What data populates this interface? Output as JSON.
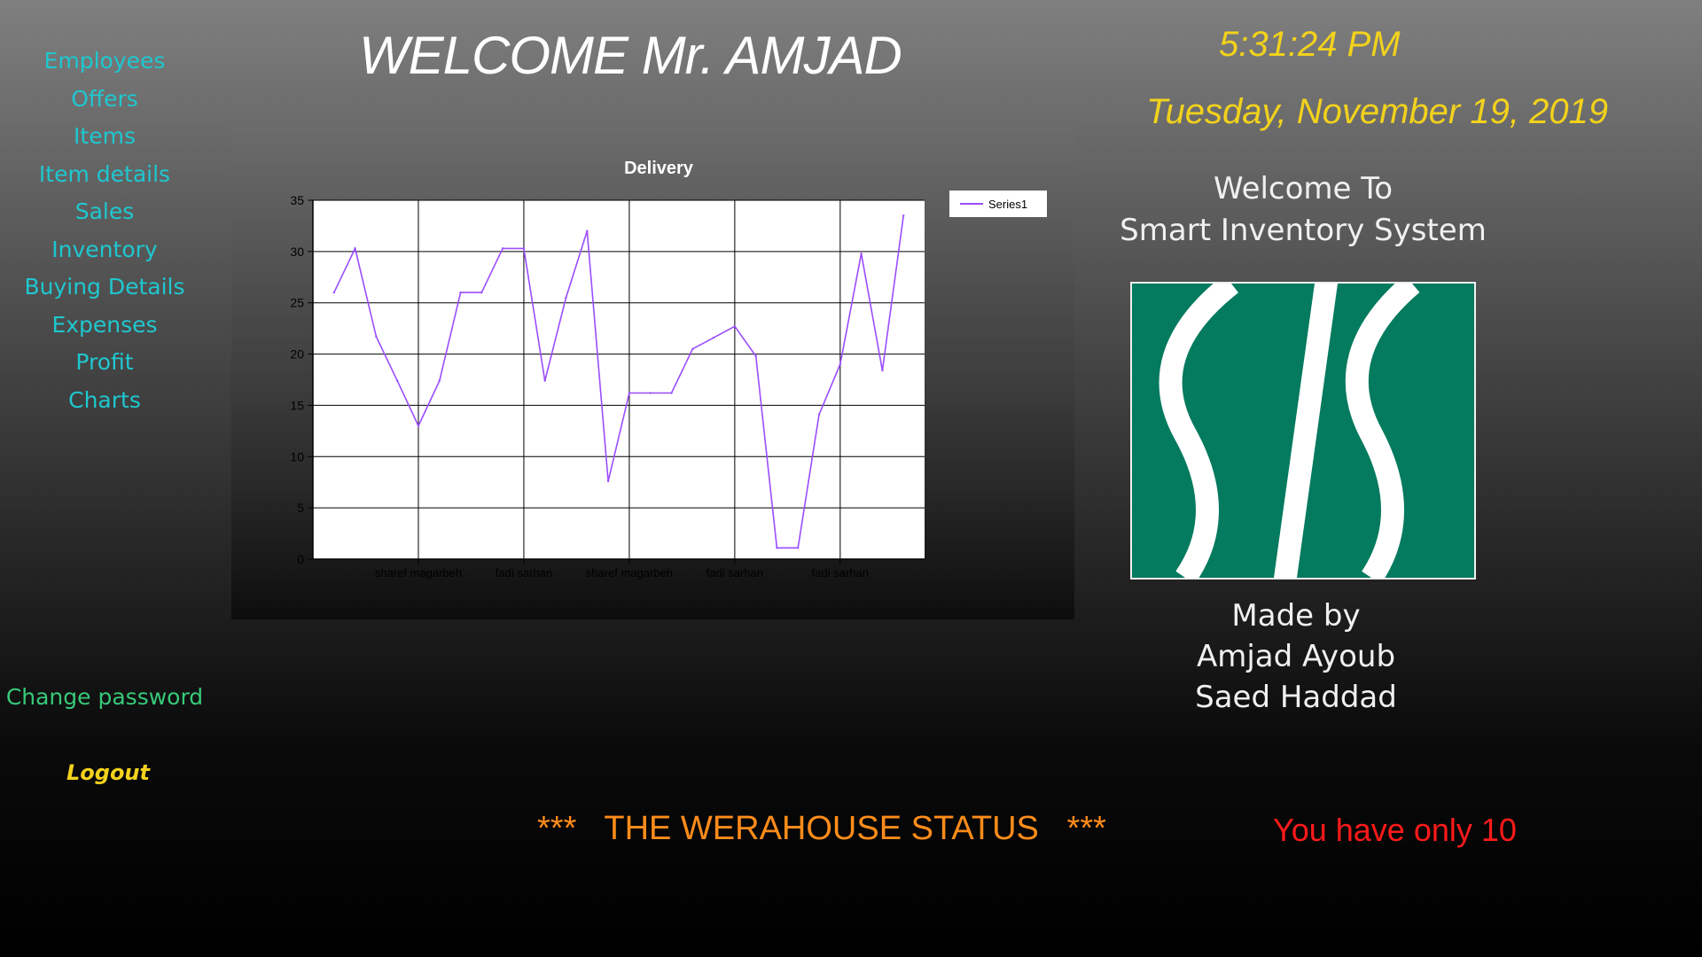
{
  "header": {
    "welcome": "WELCOME Mr. AMJAD",
    "time": "5:31:24 PM",
    "date": "Tuesday, November 19, 2019"
  },
  "nav": {
    "items": [
      {
        "label": "Employees"
      },
      {
        "label": "Offers"
      },
      {
        "label": "Items"
      },
      {
        "label": "Item details"
      },
      {
        "label": "Sales"
      },
      {
        "label": "Inventory"
      },
      {
        "label": "Buying Details"
      },
      {
        "label": "Expenses"
      },
      {
        "label": "Profit"
      },
      {
        "label": "Charts"
      }
    ],
    "change_password": "Change password",
    "logout": "Logout"
  },
  "info": {
    "welcome_line1": "Welcome To",
    "welcome_line2": "Smart Inventory System",
    "made_by": "Made by",
    "author1": "Amjad Ayoub",
    "author2": "Saed Haddad",
    "logo_alt": "SIS"
  },
  "footer": {
    "status": "***   THE WERAHOUSE STATUS   ***",
    "alert": "You have only 10"
  },
  "colors": {
    "nav": "#1fc7cf",
    "change_password": "#37c979",
    "accent_yellow": "#f2d21c",
    "status_orange": "#ff8c1a",
    "alert_red": "#ff1a1a",
    "logo_green": "#047a5e",
    "series_line": "#9b4dff"
  },
  "chart_data": {
    "type": "line",
    "title": "Delivery",
    "legend": [
      "Series1"
    ],
    "legend_position": "top-right",
    "grid": true,
    "ylim": [
      0,
      35
    ],
    "yticks": [
      0,
      5,
      10,
      15,
      20,
      25,
      30,
      35
    ],
    "xlabels": [
      "sharef magarbeh",
      "fadi sarhan",
      "sharef magarbeh",
      "fadi sarhan",
      "fadi sarhan"
    ],
    "xlabel_positions": [
      5,
      10,
      15,
      20,
      25
    ],
    "xlim": [
      0,
      29
    ],
    "series": [
      {
        "name": "Series1",
        "x": [
          1,
          2,
          3,
          4,
          5,
          6,
          7,
          8,
          9,
          10,
          11,
          12,
          13,
          14,
          15,
          16,
          17,
          18,
          19,
          20,
          21,
          22,
          23,
          24,
          25,
          26,
          27,
          28
        ],
        "values": [
          26,
          30.3,
          21.7,
          17.4,
          13,
          17.4,
          26,
          26,
          30.3,
          30.3,
          17.4,
          25.5,
          32,
          7.6,
          16.2,
          16.2,
          16.2,
          20.5,
          21.6,
          22.7,
          19.8,
          1.1,
          1.1,
          14.1,
          19,
          29.8,
          18.4,
          33.5
        ]
      }
    ]
  }
}
